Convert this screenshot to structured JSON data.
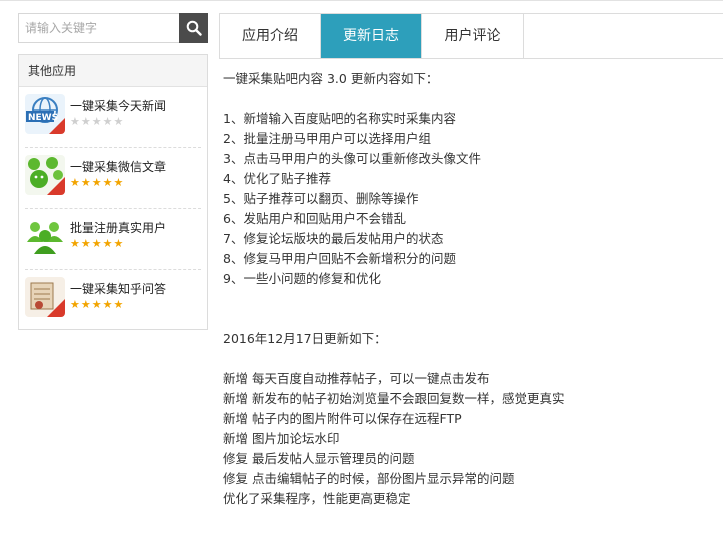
{
  "search": {
    "placeholder": "请输入关键字",
    "button_icon": "search-icon"
  },
  "sidebar": {
    "title": "其他应用",
    "items": [
      {
        "name": "一键采集今天新闻",
        "rating": 0,
        "icon": "news-icon"
      },
      {
        "name": "一键采集微信文章",
        "rating": 5,
        "icon": "wechat-icon"
      },
      {
        "name": "批量注册真实用户",
        "rating": 5,
        "icon": "users-icon"
      },
      {
        "name": "一键采集知乎问答",
        "rating": 5,
        "icon": "zhihu-icon"
      }
    ]
  },
  "tabs": [
    {
      "label": "应用介绍",
      "active": false
    },
    {
      "label": "更新日志",
      "active": true
    },
    {
      "label": "用户评论",
      "active": false
    }
  ],
  "changelog": {
    "v3_heading": "一键采集贴吧内容 3.0 更新内容如下：",
    "v3_items": [
      "1、新增输入百度贴吧的名称实时采集内容",
      "2、批量注册马甲用户可以选择用户组",
      "3、点击马甲用户的头像可以重新修改头像文件",
      "4、优化了贴子推荐",
      "5、贴子推荐可以翻页、删除等操作",
      "6、发贴用户和回贴用户不会错乱",
      "7、修复论坛版块的最后发帖用户的状态",
      "8、修复马甲用户回贴不会新增积分的问题",
      "9、一些小问题的修复和优化"
    ],
    "dec_heading": "2016年12月17日更新如下：",
    "dec_items": [
      "新增 每天百度自动推荐帖子，可以一键点击发布",
      "新增 新发布的帖子初始浏览量不会跟回复数一样，感觉更真实",
      "新增 帖子内的图片附件可以保存在远程FTP",
      "新增 图片加论坛水印",
      "修复 最后发帖人显示管理员的问题",
      "修复 点击编辑帖子的时候，部份图片显示异常的问题",
      "优化了采集程序，性能更高更稳定"
    ]
  },
  "colors": {
    "accent": "#2d9fbb",
    "star": "#f2a400",
    "search_button": "#4b4b4b"
  }
}
